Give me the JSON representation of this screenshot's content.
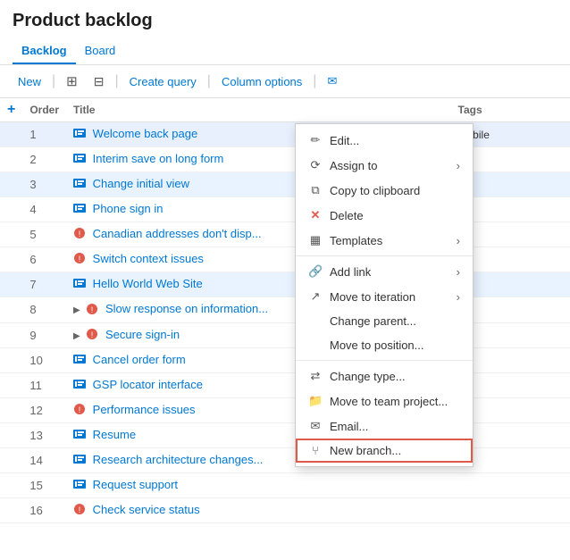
{
  "page": {
    "title": "Product backlog"
  },
  "tabs": [
    {
      "id": "backlog",
      "label": "Backlog",
      "active": true
    },
    {
      "id": "board",
      "label": "Board",
      "active": false
    }
  ],
  "toolbar": {
    "new_label": "New",
    "create_query_label": "Create query",
    "column_options_label": "Column options"
  },
  "table": {
    "columns": [
      {
        "id": "add",
        "label": ""
      },
      {
        "id": "order",
        "label": "Order"
      },
      {
        "id": "title",
        "label": "Title"
      },
      {
        "id": "dots",
        "label": ""
      },
      {
        "id": "tags",
        "label": "Tags"
      }
    ],
    "rows": [
      {
        "id": 1,
        "order": "1",
        "icon": "blue",
        "title": "Welcome back page",
        "tags": "Mobile",
        "expanded": false,
        "selected": true,
        "show_dots": true
      },
      {
        "id": 2,
        "order": "2",
        "icon": "blue",
        "title": "Interim save on long form",
        "tags": "",
        "expanded": false,
        "selected": false
      },
      {
        "id": 3,
        "order": "3",
        "icon": "blue",
        "title": "Change initial view",
        "tags": "",
        "expanded": false,
        "selected": false,
        "highlighted": true
      },
      {
        "id": 4,
        "order": "4",
        "icon": "blue",
        "title": "Phone sign in",
        "tags": "",
        "expanded": false,
        "selected": false
      },
      {
        "id": 5,
        "order": "5",
        "icon": "red",
        "title": "Canadian addresses don't disp...",
        "tags": "",
        "expanded": false,
        "selected": false
      },
      {
        "id": 6,
        "order": "6",
        "icon": "red",
        "title": "Switch context issues",
        "tags": "",
        "expanded": false,
        "selected": false
      },
      {
        "id": 7,
        "order": "7",
        "icon": "blue",
        "title": "Hello World Web Site",
        "tags": "",
        "expanded": false,
        "selected": false,
        "highlighted": true
      },
      {
        "id": 8,
        "order": "8",
        "icon": "red",
        "title": "Slow response on information...",
        "tags": "",
        "expanded": true,
        "selected": false
      },
      {
        "id": 9,
        "order": "9",
        "icon": "red",
        "title": "Secure sign-in",
        "tags": "",
        "expanded": true,
        "selected": false
      },
      {
        "id": 10,
        "order": "10",
        "icon": "blue",
        "title": "Cancel order form",
        "tags": "",
        "expanded": false,
        "selected": false
      },
      {
        "id": 11,
        "order": "11",
        "icon": "blue",
        "title": "GSP locator interface",
        "tags": "",
        "expanded": false,
        "selected": false
      },
      {
        "id": 12,
        "order": "12",
        "icon": "red",
        "title": "Performance issues",
        "tags": "",
        "expanded": false,
        "selected": false
      },
      {
        "id": 13,
        "order": "13",
        "icon": "blue",
        "title": "Resume",
        "tags": "",
        "expanded": false,
        "selected": false
      },
      {
        "id": 14,
        "order": "14",
        "icon": "blue",
        "title": "Research architecture changes...",
        "tags": "",
        "expanded": false,
        "selected": false
      },
      {
        "id": 15,
        "order": "15",
        "icon": "blue",
        "title": "Request support",
        "tags": "",
        "expanded": false,
        "selected": false
      },
      {
        "id": 16,
        "order": "16",
        "icon": "red",
        "title": "Check service status",
        "tags": "",
        "expanded": false,
        "selected": false
      }
    ]
  },
  "context_menu": {
    "items": [
      {
        "id": "edit",
        "label": "Edit...",
        "icon": "✏️",
        "has_arrow": false
      },
      {
        "id": "assign_to",
        "label": "Assign to",
        "icon": "👤",
        "has_arrow": true
      },
      {
        "id": "copy_clipboard",
        "label": "Copy to clipboard",
        "icon": "📋",
        "has_arrow": false
      },
      {
        "id": "delete",
        "label": "Delete",
        "icon": "✕",
        "has_arrow": false,
        "red_icon": true
      },
      {
        "id": "templates",
        "label": "Templates",
        "icon": "▦",
        "has_arrow": true
      },
      {
        "id": "sep1",
        "separator": true
      },
      {
        "id": "add_link",
        "label": "Add link",
        "icon": "🔗",
        "has_arrow": true
      },
      {
        "id": "move_iteration",
        "label": "Move to iteration",
        "icon": "↗",
        "has_arrow": true
      },
      {
        "id": "change_parent",
        "label": "Change parent...",
        "icon": "",
        "has_arrow": false
      },
      {
        "id": "move_position",
        "label": "Move to position...",
        "icon": "",
        "has_arrow": false
      },
      {
        "id": "sep2",
        "separator": true
      },
      {
        "id": "change_type",
        "label": "Change type...",
        "icon": "⇄",
        "has_arrow": false
      },
      {
        "id": "move_team",
        "label": "Move to team project...",
        "icon": "📁",
        "has_arrow": false
      },
      {
        "id": "email",
        "label": "Email...",
        "icon": "✉",
        "has_arrow": false
      },
      {
        "id": "new_branch",
        "label": "New branch...",
        "icon": "⑂",
        "has_arrow": false,
        "highlighted": true
      }
    ]
  }
}
